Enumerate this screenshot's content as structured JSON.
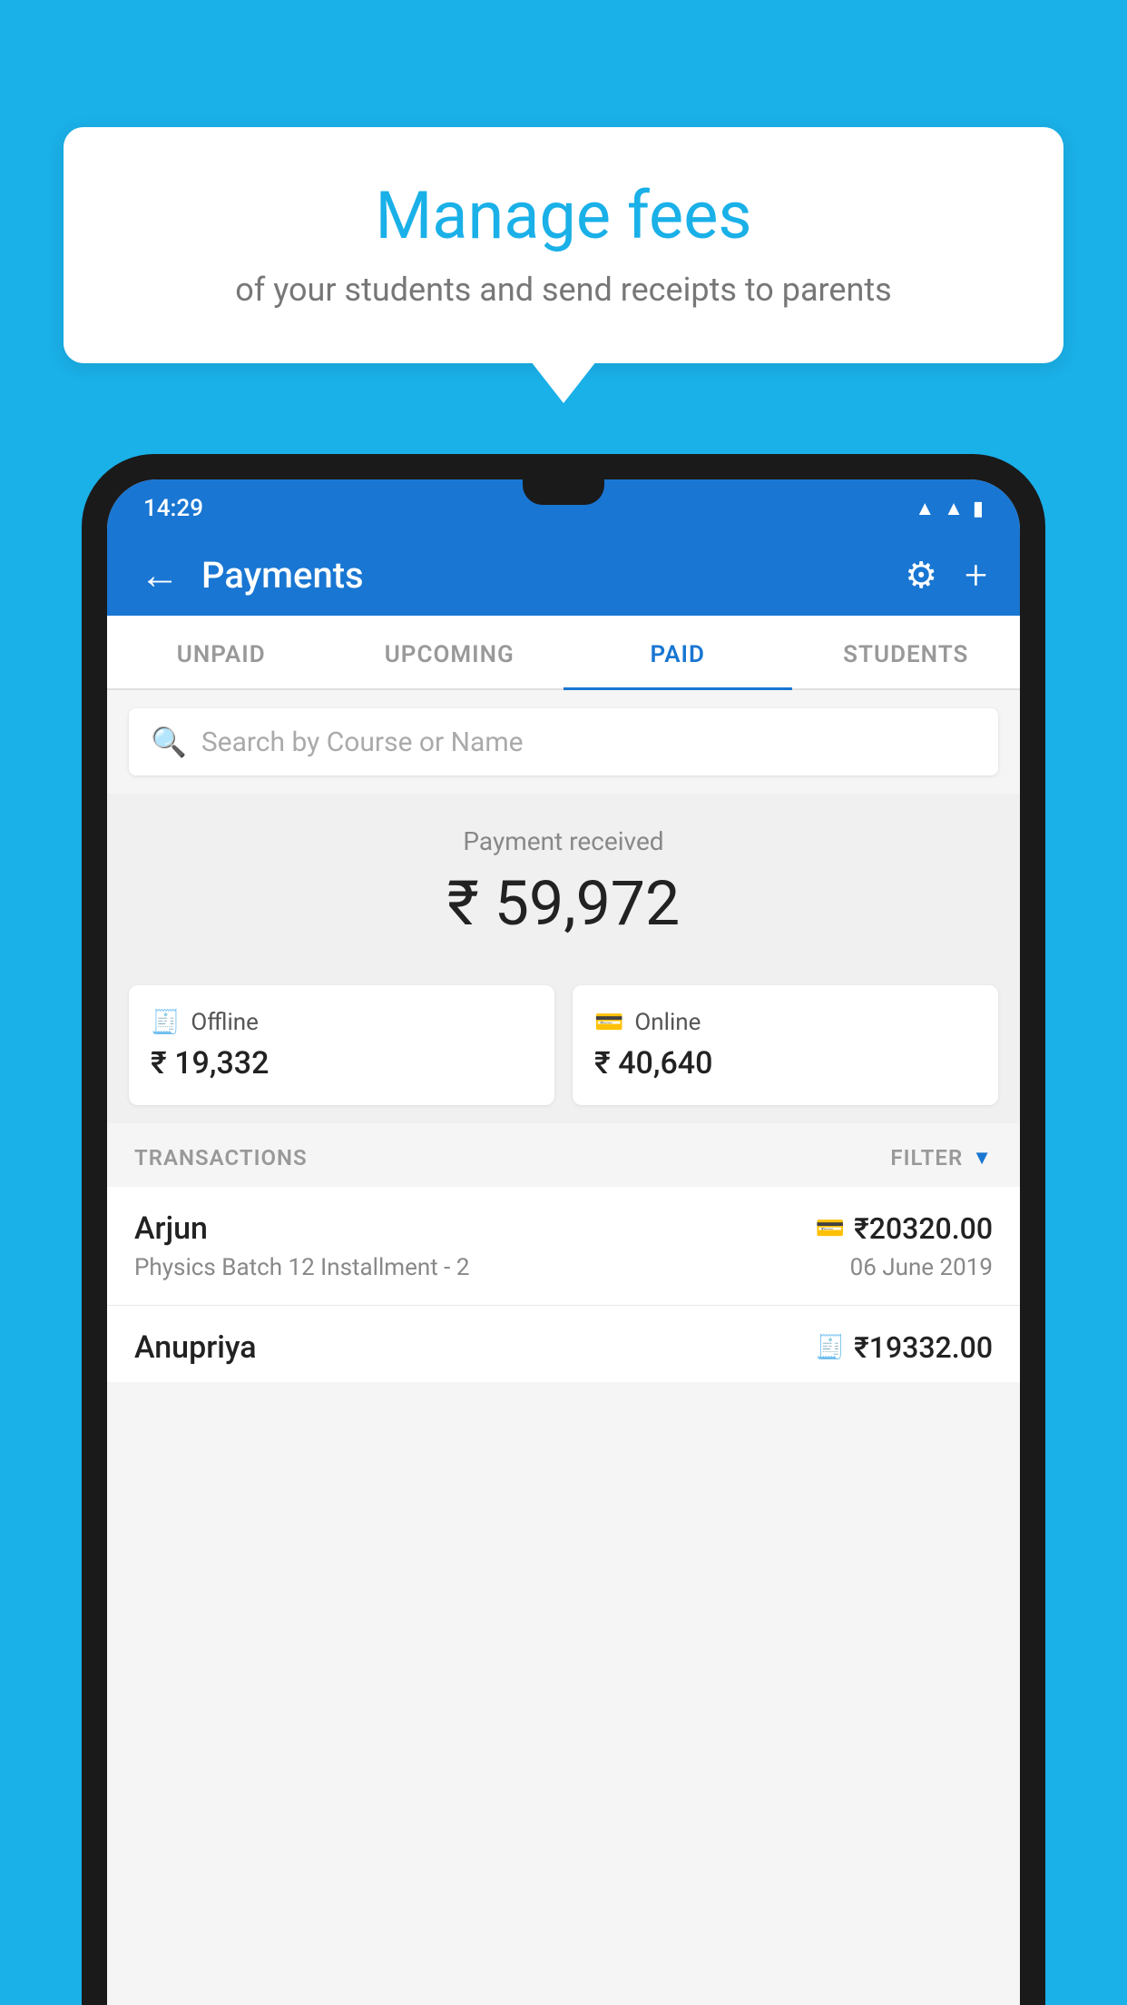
{
  "background_color": "#1ab0e8",
  "speech_bubble": {
    "title": "Manage fees",
    "subtitle": "of your students and send receipts to parents"
  },
  "status_bar": {
    "time": "14:29",
    "icons": [
      "wifi",
      "signal",
      "battery"
    ]
  },
  "app_bar": {
    "title": "Payments",
    "back_label": "←",
    "gear_label": "⚙",
    "plus_label": "+"
  },
  "tabs": [
    {
      "label": "UNPAID",
      "active": false
    },
    {
      "label": "UPCOMING",
      "active": false
    },
    {
      "label": "PAID",
      "active": true
    },
    {
      "label": "STUDENTS",
      "active": false
    }
  ],
  "search": {
    "placeholder": "Search by Course or Name"
  },
  "payment_summary": {
    "label": "Payment received",
    "amount": "₹ 59,972",
    "offline": {
      "label": "Offline",
      "amount": "₹ 19,332"
    },
    "online": {
      "label": "Online",
      "amount": "₹ 40,640"
    }
  },
  "transactions": {
    "section_label": "TRANSACTIONS",
    "filter_label": "FILTER",
    "items": [
      {
        "name": "Arjun",
        "amount": "₹20320.00",
        "course": "Physics Batch 12 Installment - 2",
        "date": "06 June 2019",
        "payment_type": "card"
      },
      {
        "name": "Anupriya",
        "amount": "₹19332.00",
        "course": "",
        "date": "",
        "payment_type": "offline"
      }
    ]
  }
}
